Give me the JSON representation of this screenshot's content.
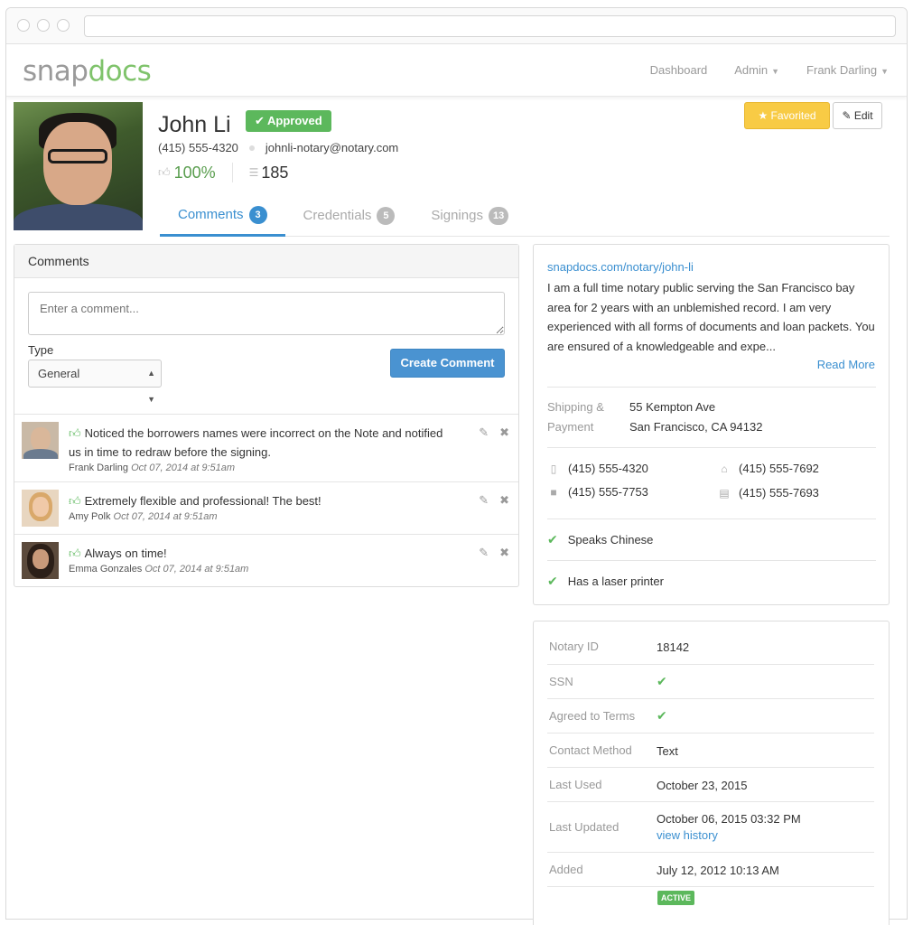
{
  "app": {
    "logo_snap": "snap",
    "logo_docs": "docs",
    "nav": [
      "Dashboard",
      "Admin",
      "Frank Darling"
    ]
  },
  "profile": {
    "name": "John Li",
    "status": "Approved",
    "phone": "(415) 555-4320",
    "email": "johnli-notary@notary.com",
    "rating": "100%",
    "signings_count": "185",
    "favorite_label": "Favorited",
    "edit_label": "Edit"
  },
  "tabs": [
    {
      "label": "Comments",
      "count": "3"
    },
    {
      "label": "Credentials",
      "count": "5"
    },
    {
      "label": "Signings",
      "count": "13"
    }
  ],
  "comments_panel": {
    "title": "Comments",
    "placeholder": "Enter a comment...",
    "type_label": "Type",
    "type_value": "General",
    "create_label": "Create Comment",
    "items": [
      {
        "text": "Noticed the borrowers names were incorrect on the Note and notified us in time to redraw before the signing.",
        "author": "Frank Darling",
        "date": "Oct 07, 2014 at 9:51am"
      },
      {
        "text": "Extremely flexible and professional! The best!",
        "author": "Amy Polk",
        "date": "Oct 07, 2014 at 9:51am"
      },
      {
        "text": "Always on time!",
        "author": "Emma Gonzales",
        "date": "Oct 07, 2014 at 9:51am"
      }
    ]
  },
  "info": {
    "profile_url": "snapdocs.com/notary/john-li",
    "bio": "I am a full time notary public serving the San Francisco bay area for 2 years with an unblemished record. I am very experienced with all forms of documents and loan packets. You are ensured of a knowledgeable and expe...",
    "read_more": "Read More",
    "shipping_label_1": "Shipping &",
    "shipping_label_2": "Payment",
    "address_1": "55 Kempton Ave",
    "address_2": "San Francisco, CA 94132",
    "mobile": "(415) 555-4320",
    "home": "(415) 555-7692",
    "work": "(415) 555-7753",
    "fax": "(415) 555-7693",
    "features": [
      "Speaks Chinese",
      "Has a laser printer"
    ]
  },
  "details": {
    "notary_id_label": "Notary ID",
    "notary_id": "18142",
    "ssn_label": "SSN",
    "terms_label": "Agreed to Terms",
    "contact_method_label": "Contact Method",
    "contact_method": "Text",
    "last_used_label": "Last Used",
    "last_used": "October 23, 2015",
    "last_updated_label": "Last Updated",
    "last_updated": "October 06, 2015 03:32 PM",
    "view_history": "view history",
    "added_label": "Added",
    "added": "July 12, 2012 10:13 AM",
    "status_badge": "ACTIVE"
  },
  "colors": {
    "brand_green": "#7fc36b",
    "link_blue": "#3a8fd0",
    "approved_green": "#5cb85c",
    "favorite_yellow": "#f8cb45"
  }
}
